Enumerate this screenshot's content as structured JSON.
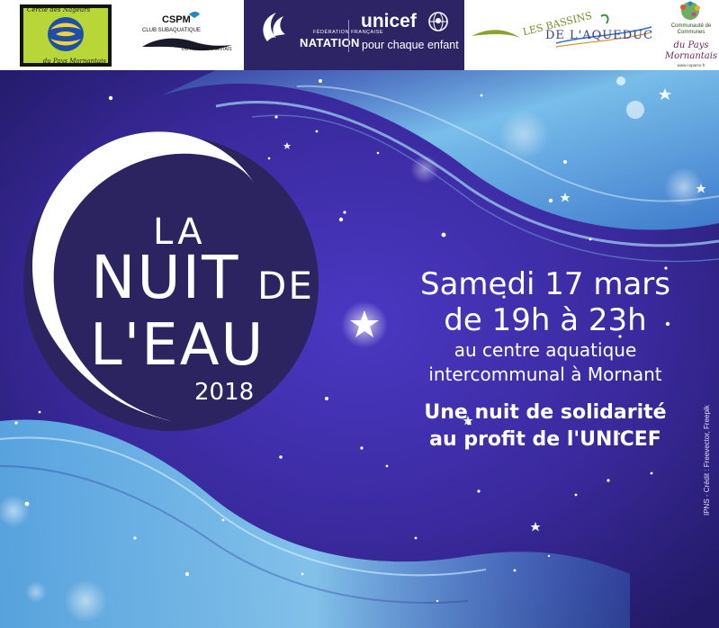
{
  "logos": {
    "cnpm": {
      "line1": "Cercle des Nageurs",
      "line2": "du Pays Mornantais"
    },
    "cspm": {
      "name": "CSPM",
      "line1": "CLUB SUBAQUATIQUE",
      "line2": "DU PAYS MORNANTAIS"
    },
    "ffn": {
      "federation": "FÉDÉRATION FRANÇAISE",
      "natation": "NATATION"
    },
    "unicef": {
      "name": "unicef",
      "tagline": "pour chaque enfant"
    },
    "aqueduc": {
      "line1": "LES BASSINS",
      "line2": "DE L'AQUEDUC"
    },
    "copamo": {
      "line1": "Communauté de Communes",
      "line2": "du Pays",
      "line3": "Mornantais",
      "url": "www.copamo.fr"
    }
  },
  "event": {
    "title_la": "LA",
    "title_nuit": "NUIT",
    "title_de": "DE",
    "title_leau": "L'EAU",
    "year": "2018"
  },
  "info": {
    "date": "Samedi 17 mars",
    "hours": "de 19h à 23h",
    "place_line1": "au centre aquatique",
    "place_line2": "intercommunal à Mornant",
    "solidarity_line1": "Une nuit de solidarité",
    "solidarity_line2": "au profit de l'UNICEF"
  },
  "credit": "IPNS - Crédit : Freevector, Freepik",
  "colors": {
    "background": "#3a2a9e",
    "moon_disk": "#2b2460",
    "water": "#6fb9e8",
    "ffn_band": "#2d2466"
  }
}
